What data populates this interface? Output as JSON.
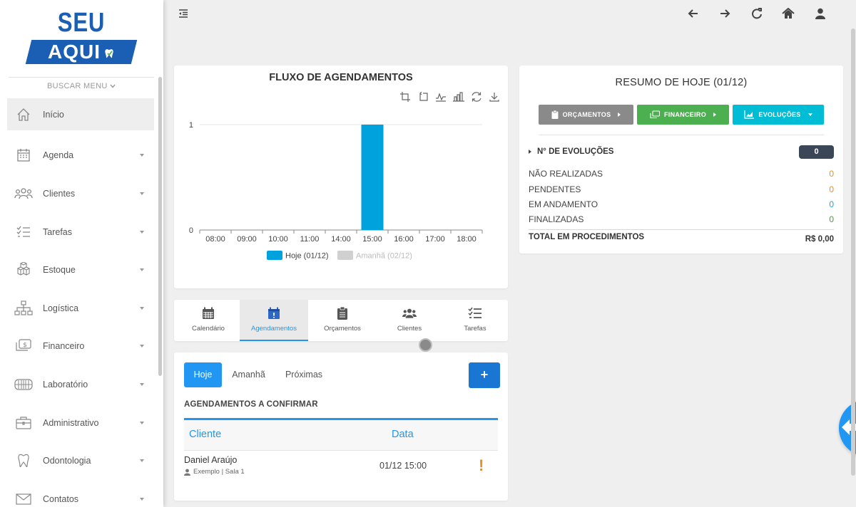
{
  "logo": {
    "line1": "SEU LOGO",
    "line2": "AQUI"
  },
  "sidebar": {
    "search_label": "BUSCAR MENU",
    "items": [
      {
        "label": "Início",
        "icon": "home-icon"
      },
      {
        "label": "Agenda",
        "icon": "calendar-icon"
      },
      {
        "label": "Clientes",
        "icon": "users-icon"
      },
      {
        "label": "Tarefas",
        "icon": "tasks-icon"
      },
      {
        "label": "Estoque",
        "icon": "boxes-icon"
      },
      {
        "label": "Logística",
        "icon": "sitemap-icon"
      },
      {
        "label": "Financeiro",
        "icon": "money-icon"
      },
      {
        "label": "Laboratório",
        "icon": "teeth-icon"
      },
      {
        "label": "Administrativo",
        "icon": "briefcase-icon"
      },
      {
        "label": "Odontologia",
        "icon": "tooth-icon"
      },
      {
        "label": "Contatos",
        "icon": "envelope-icon"
      }
    ]
  },
  "topbar": {
    "icons": [
      "arrow-left-icon",
      "arrow-right-icon",
      "refresh-icon",
      "home-icon",
      "user-icon"
    ]
  },
  "chart_card": {
    "title": "FLUXO DE AGENDAMENTOS",
    "tools": [
      "zoom-select-icon",
      "zoom-reset-icon",
      "line-chart-icon",
      "bar-chart-icon",
      "restore-icon",
      "download-icon"
    ]
  },
  "chart_data": {
    "type": "bar",
    "title": "FLUXO DE AGENDAMENTOS",
    "categories": [
      "08:00",
      "09:00",
      "10:00",
      "11:00",
      "14:00",
      "15:00",
      "16:00",
      "17:00",
      "18:00"
    ],
    "series": [
      {
        "name": "Hoje (01/12)",
        "values": [
          0,
          0,
          0,
          0,
          0,
          1,
          0,
          0,
          0
        ],
        "color": "#00a2de"
      },
      {
        "name": "Amanhã (02/12)",
        "values": [
          0,
          0,
          0,
          0,
          0,
          0,
          0,
          0,
          0
        ],
        "color": "#d0d0d0"
      }
    ],
    "yticks": [
      "0",
      "1"
    ],
    "ylim": [
      0,
      1
    ],
    "legend": "bottom",
    "grid": true
  },
  "tabs": [
    {
      "label": "Calendário",
      "icon": "calendar-icon"
    },
    {
      "label": "Agendamentos",
      "icon": "calendar-alert-icon"
    },
    {
      "label": "Orçamentos",
      "icon": "clipboard-icon"
    },
    {
      "label": "Clientes",
      "icon": "users-icon"
    },
    {
      "label": "Tarefas",
      "icon": "tasks-icon"
    }
  ],
  "appointments": {
    "pills": [
      "Hoje",
      "Amanhã",
      "Próximas"
    ],
    "add_label": "+",
    "heading": "AGENDAMENTOS A CONFIRMAR",
    "columns": [
      "Cliente",
      "Data"
    ],
    "rows": [
      {
        "name": "Daniel Araújo",
        "sub": "Exemplo | Sala 1",
        "date": "01/12 15:00",
        "alert": "!"
      }
    ]
  },
  "summary": {
    "title": "RESUMO DE HOJE (01/12)",
    "buttons": [
      {
        "label": "ORÇAMENTOS",
        "color": "#8a8a8a"
      },
      {
        "label": "FINANCEIRO",
        "color": "#4caf50"
      },
      {
        "label": "EVOLUÇÕES",
        "color": "#00bcd4"
      }
    ],
    "evolutions_label": "N° DE EVOLUÇÕES",
    "evolutions_count": "0",
    "stats": [
      {
        "label": "NÃO REALIZADAS",
        "value": "0",
        "color": "#e39122"
      },
      {
        "label": "PENDENTES",
        "value": "0",
        "color": "#e39122"
      },
      {
        "label": "EM ANDAMENTO",
        "value": "0",
        "color": "#1aa6d8"
      },
      {
        "label": "FINALIZADAS",
        "value": "0",
        "color": "#43a047"
      }
    ],
    "total_label": "TOTAL EM PROCEDIMENTOS",
    "total_value": "R$ 0,00"
  }
}
